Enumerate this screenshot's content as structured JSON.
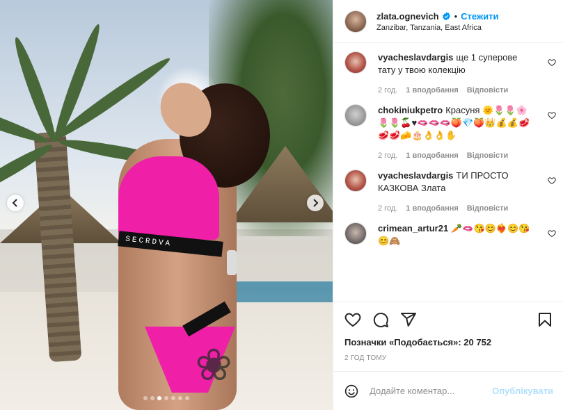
{
  "photo": {
    "band_text": "SECRDVA",
    "dots_total": 7,
    "dots_active_index": 2
  },
  "header": {
    "username": "zlata.ognevich",
    "separator": "•",
    "follow_label": "Стежити",
    "location": "Zanzibar, Tanzania, East Africa",
    "verified_color": "#0095f6"
  },
  "comments": [
    {
      "user": "vyacheslavdargis",
      "text": "ще 1 суперове тату у твою колекцію",
      "time": "2 год.",
      "likes": "1 вподобання",
      "reply": "Відповісти"
    },
    {
      "user": "chokiniukpetro",
      "text": "Красуня 🌞🌷🌷🌸🌷🌷🍒♥🫦🫦🫦🍑💎🍑👑💰💰🥩🥩🥩🧀🎂👌👌✋",
      "time": "2 год.",
      "likes": "1 вподобання",
      "reply": "Відповісти"
    },
    {
      "user": "vyacheslavdargis",
      "text": "ТИ ПРОСТО КАЗКОВА Злата",
      "time": "2 год.",
      "likes": "1 вподобання",
      "reply": "Відповісти"
    },
    {
      "user": "crimean_artur21",
      "text": "🥕🫦😘😊❤️‍🔥😊😘😊🙈",
      "time": "",
      "likes": "",
      "reply": ""
    }
  ],
  "actions": {
    "likes_text": "Позначки «Подобається»: 20 752",
    "time_ago": "2 ГОД ТОМУ"
  },
  "add_comment": {
    "placeholder": "Додайте коментар...",
    "post_label": "Опублікувати"
  },
  "colors": {
    "accent": "#0095f6",
    "bikini": "#ef1fa8",
    "muted_text": "#8e8e8e"
  }
}
